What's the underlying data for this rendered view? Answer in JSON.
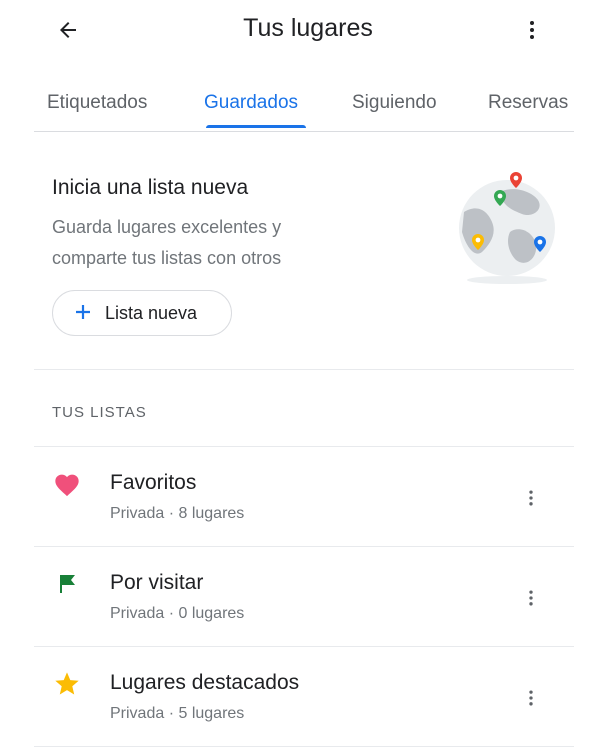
{
  "app_bar": {
    "title": "Tus lugares",
    "back_icon": "arrow-back-icon",
    "menu_icon": "more-vert-icon"
  },
  "tabs": [
    {
      "label": "Etiquetados",
      "active": false
    },
    {
      "label": "Guardados",
      "active": true
    },
    {
      "label": "Siguiendo",
      "active": false
    },
    {
      "label": "Reservas",
      "active": false
    }
  ],
  "promo": {
    "title": "Inicia una lista nueva",
    "body": "Guarda lugares excelentes y comparte tus listas con otros",
    "button_label": "Lista nueva",
    "button_icon": "plus-icon",
    "illustration": "globe-pins-illustration"
  },
  "lists": {
    "header": "TUS LISTAS",
    "items": [
      {
        "name": "Favoritos",
        "meta": "Privada · 8 lugares",
        "icon": "heart-icon",
        "color": "#f0507b"
      },
      {
        "name": "Por visitar",
        "meta": "Privada · 0 lugares",
        "icon": "flag-icon",
        "color": "#188038"
      },
      {
        "name": "Lugares destacados",
        "meta": "Privada · 5 lugares",
        "icon": "star-icon",
        "color": "#fbbc04"
      }
    ]
  },
  "colors": {
    "accent": "#1a73e8",
    "text_primary": "#202124",
    "text_secondary": "#70757a",
    "divider": "#dadce0"
  }
}
